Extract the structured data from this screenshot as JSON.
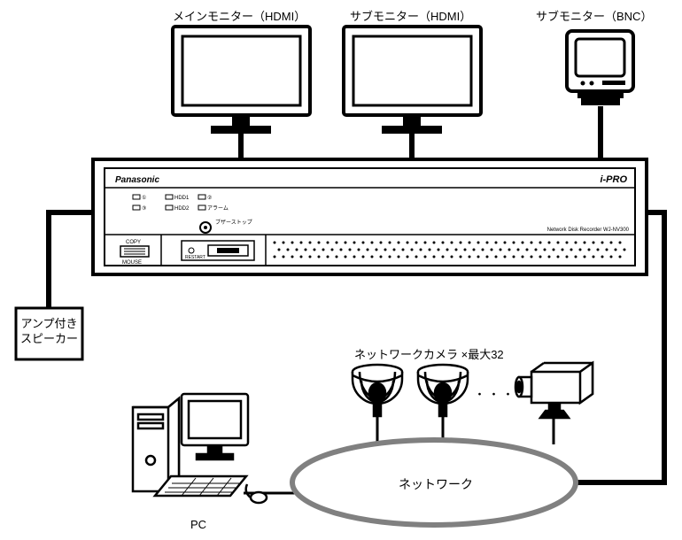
{
  "labels": {
    "main_monitor": "メインモニター（HDMI）",
    "sub_monitor_hdmi": "サブモニター（HDMI）",
    "sub_monitor_bnc": "サブモニター（BNC）",
    "speaker": "アンプ付き\nスピーカー",
    "cameras": "ネットワークカメラ ×最大32",
    "network": "ネットワーク",
    "pc": "PC",
    "ellipsis": "・・・"
  },
  "recorder": {
    "brand": "Panasonic",
    "right_logo": "i-PRO",
    "model_text": "Network Disk Recorder WJ-NV300",
    "led_row1": [
      "①",
      "HDD1",
      "②"
    ],
    "led_row2": [
      "③",
      "HDD2",
      "アラーム"
    ],
    "buzzer_label": "ブザーストップ",
    "copy": "COPY",
    "mouse": "MOUSE",
    "restart": "RESTART"
  },
  "diagram": {
    "description": "Network video recorder system connection diagram",
    "components": [
      {
        "name": "main-monitor",
        "type": "display",
        "connection": "HDMI"
      },
      {
        "name": "sub-monitor-hdmi",
        "type": "display",
        "connection": "HDMI"
      },
      {
        "name": "sub-monitor-bnc",
        "type": "display",
        "connection": "BNC"
      },
      {
        "name": "recorder",
        "type": "nvr"
      },
      {
        "name": "amplified-speaker",
        "type": "audio"
      },
      {
        "name": "pc",
        "type": "computer"
      },
      {
        "name": "network-cameras",
        "type": "camera",
        "max_count": 32
      },
      {
        "name": "network",
        "type": "network"
      }
    ]
  }
}
